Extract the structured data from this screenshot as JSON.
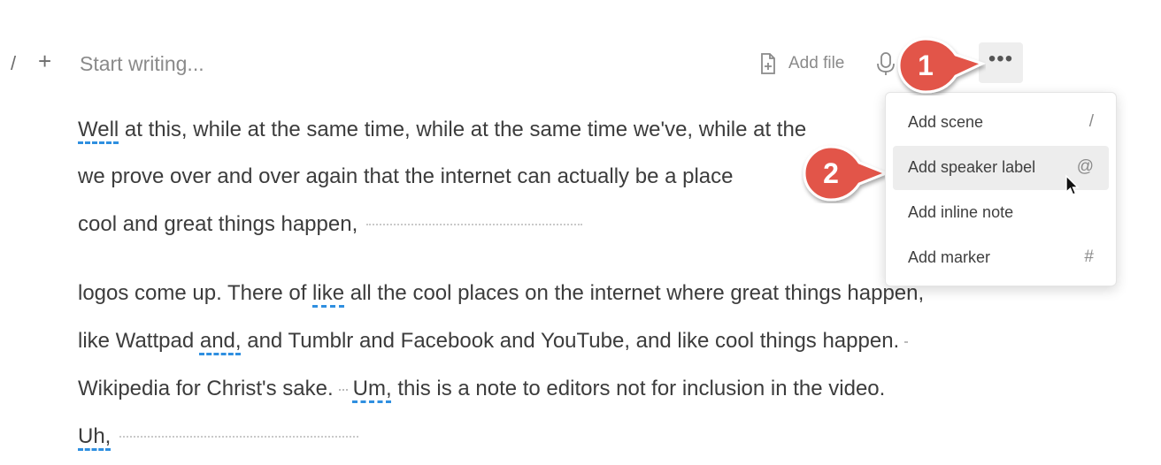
{
  "toolbar": {
    "slash": "/",
    "plus": "+",
    "prompt": "Start writing...",
    "add_file_label": "Add file",
    "more_label": "•••"
  },
  "paragraph1": {
    "line1_flag": "Well",
    "line1_rest": " at this, while at the same time, while at the same time we've, while at the",
    "line2": "we prove over and over again that the internet can actually be a place",
    "line3": "cool and great things happen,"
  },
  "paragraph2": {
    "line1_a": "logos come up. There of ",
    "line1_flag": "like",
    "line1_b": " all the cool places on the internet where great things happen,",
    "line2_a": "like Wattpad ",
    "line2_flag": "and,",
    "line2_b": " and Tumblr and Facebook and YouTube, and like cool things happen.",
    "line3_a": "Wikipedia for Christ's sake.",
    "line3_flag": "Um,",
    "line3_b": " this is a note to editors not for inclusion in the video.",
    "line4_flag": "Uh,"
  },
  "menu": {
    "items": [
      {
        "label": "Add scene",
        "shortcut": "/"
      },
      {
        "label": "Add speaker label",
        "shortcut": "@"
      },
      {
        "label": "Add inline note",
        "shortcut": ""
      },
      {
        "label": "Add marker",
        "shortcut": "#"
      }
    ]
  },
  "callouts": {
    "one": "1",
    "two": "2",
    "color": "#e2554a"
  }
}
